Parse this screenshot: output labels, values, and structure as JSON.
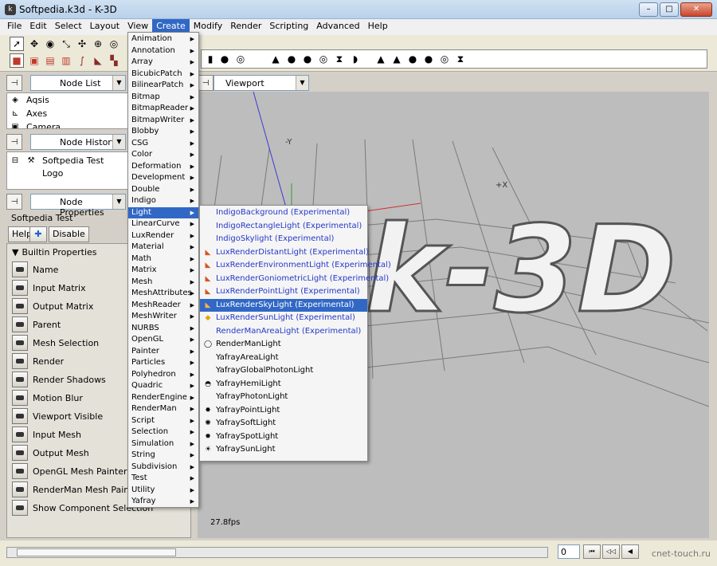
{
  "window": {
    "title": "Softpedia.k3d - K-3D",
    "minimize_label": "–",
    "maximize_label": "□",
    "close_label": "✕",
    "app_icon": "k3d-icon"
  },
  "menubar": [
    "File",
    "Edit",
    "Select",
    "Layout",
    "View",
    "Create",
    "Modify",
    "Render",
    "Scripting",
    "Advanced",
    "Help"
  ],
  "left_panels": {
    "node_list": {
      "combo_label": "Node List",
      "items": [
        {
          "label": "Aqsis",
          "icon": "render-engine-icon"
        },
        {
          "label": "Axes",
          "icon": "axes-icon"
        },
        {
          "label": "Camera",
          "icon": "camera-icon"
        }
      ]
    },
    "node_history": {
      "combo_label": "Node History",
      "items": [
        {
          "label": "Softpedia Test",
          "expander": "⊟",
          "icon": "mesh-icon"
        },
        {
          "label": "Logo"
        }
      ]
    },
    "node_properties": {
      "combo_label": "Node Properties",
      "node_name": "Softpedia Test",
      "buttons": {
        "help": "Help",
        "disable": "Disable"
      },
      "section_label": "Builtin Properties",
      "properties": [
        "Name",
        "Input Matrix",
        "Output Matrix",
        "Parent",
        "Mesh Selection",
        "Render",
        "Render Shadows",
        "Motion Blur",
        "Viewport Visible",
        "Input Mesh",
        "Output Mesh",
        "OpenGL Mesh Painter",
        "RenderMan Mesh Painter",
        "Show Component Selection"
      ]
    }
  },
  "viewport": {
    "combo_label": "Viewport",
    "fps": "27.8fps",
    "axis_label_x": "+X",
    "axis_label_y": "-Y",
    "logo_text": "k-3D"
  },
  "create_menu": {
    "items": [
      "Animation",
      "Annotation",
      "Array",
      "BicubicPatch",
      "BilinearPatch",
      "Bitmap",
      "BitmapReader",
      "BitmapWriter",
      "Blobby",
      "CSG",
      "Color",
      "Deformation",
      "Development",
      "Double",
      "Indigo",
      "Light",
      "LinearCurve",
      "LuxRender",
      "Material",
      "Math",
      "Matrix",
      "Mesh",
      "MeshAttributes",
      "MeshReader",
      "MeshWriter",
      "NURBS",
      "OpenGL",
      "Painter",
      "Particles",
      "Polyhedron",
      "Quadric",
      "RenderEngine",
      "RenderMan",
      "Script",
      "Selection",
      "Simulation",
      "String",
      "Subdivision",
      "Test",
      "Utility",
      "Yafray"
    ],
    "highlighted": "Light",
    "submenu_arrow": "▶"
  },
  "light_submenu": {
    "items": [
      {
        "label": "IndigoBackground (Experimental)",
        "experimental": true
      },
      {
        "label": "IndigoRectangleLight (Experimental)",
        "experimental": true
      },
      {
        "label": "IndigoSkylight (Experimental)",
        "experimental": true
      },
      {
        "label": "LuxRenderDistantLight (Experimental)",
        "experimental": true,
        "icon": "lux-icon"
      },
      {
        "label": "LuxRenderEnvironmentLight (Experimental)",
        "experimental": true,
        "icon": "lux-icon"
      },
      {
        "label": "LuxRenderGoniometricLight (Experimental)",
        "experimental": true,
        "icon": "lux-icon"
      },
      {
        "label": "LuxRenderPointLight (Experimental)",
        "experimental": true,
        "icon": "lux-icon"
      },
      {
        "label": "LuxRenderSkyLight (Experimental)",
        "experimental": true,
        "icon": "lux-icon",
        "highlighted": true
      },
      {
        "label": "LuxRenderSunLight (Experimental)",
        "experimental": true,
        "icon": "sun-icon"
      },
      {
        "label": "RenderManAreaLight (Experimental)",
        "experimental": true
      },
      {
        "label": "RenderManLight",
        "icon": "bulb-icon"
      },
      {
        "label": "YafrayAreaLight"
      },
      {
        "label": "YafrayGlobalPhotonLight"
      },
      {
        "label": "YafrayHemiLight",
        "icon": "hemi-light-icon"
      },
      {
        "label": "YafrayPhotonLight"
      },
      {
        "label": "YafrayPointLight",
        "icon": "point-light-icon"
      },
      {
        "label": "YafraySoftLight",
        "icon": "soft-light-icon"
      },
      {
        "label": "YafraySpotLight",
        "icon": "spot-light-icon"
      },
      {
        "label": "YafraySunLight",
        "icon": "sun-light-icon"
      }
    ]
  },
  "timeline": {
    "frame": "0",
    "watermark": "cnet-touch.ru"
  },
  "colors": {
    "menu_highlight": "#3168c5",
    "experimental_text": "#2538c8",
    "viewport_bg": "#bdbdbd"
  }
}
